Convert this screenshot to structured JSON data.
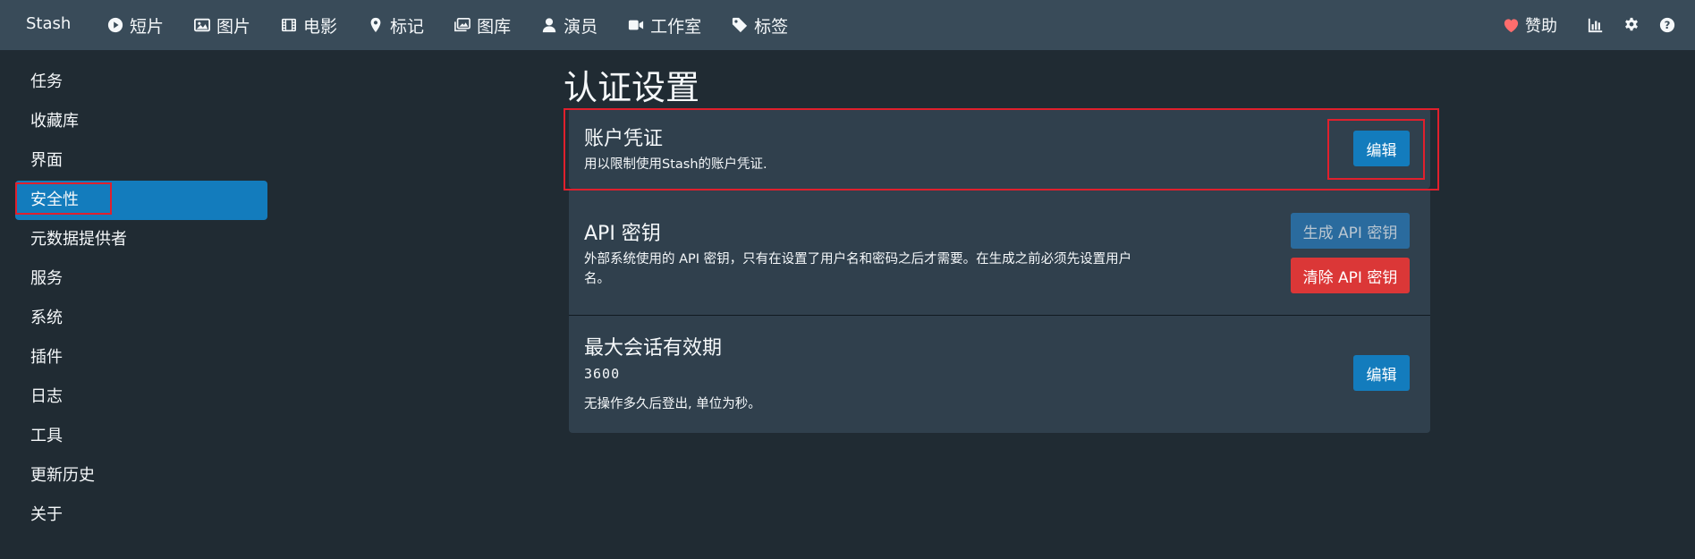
{
  "navbar": {
    "brand": "Stash",
    "items": [
      {
        "label": "短片",
        "icon": "play-circle-icon"
      },
      {
        "label": "图片",
        "icon": "image-icon"
      },
      {
        "label": "电影",
        "icon": "film-icon"
      },
      {
        "label": "标记",
        "icon": "map-marker-icon"
      },
      {
        "label": "图库",
        "icon": "images-icon"
      },
      {
        "label": "演员",
        "icon": "user-icon"
      },
      {
        "label": "工作室",
        "icon": "video-icon"
      },
      {
        "label": "标签",
        "icon": "tag-icon"
      }
    ],
    "donate_label": "赞助",
    "right_icons": [
      "chart-icon",
      "gear-icon",
      "help-icon"
    ]
  },
  "sidebar": {
    "items": [
      {
        "label": "任务"
      },
      {
        "label": "收藏库"
      },
      {
        "label": "界面"
      },
      {
        "label": "安全性",
        "active": true
      },
      {
        "label": "元数据提供者"
      },
      {
        "label": "服务"
      },
      {
        "label": "系统"
      },
      {
        "label": "插件"
      },
      {
        "label": "日志"
      },
      {
        "label": "工具"
      },
      {
        "label": "更新历史"
      },
      {
        "label": "关于"
      }
    ]
  },
  "main": {
    "title": "认证设置",
    "credentials": {
      "title": "账户凭证",
      "description": "用以限制使用Stash的账户凭证.",
      "edit_label": "编辑"
    },
    "api_key": {
      "title": "API 密钥",
      "description_line1": "外部系统使用的 API 密钥，只有在设置了用户名和密码之后才需要。在生成之前必须先设置用户",
      "description_line2": "名。",
      "generate_label": "生成 API 密钥",
      "clear_label": "清除 API 密钥"
    },
    "session": {
      "title": "最大会话有效期",
      "value": "3600",
      "description": "无操作多久后登出, 单位为秒。",
      "edit_label": "编辑"
    }
  },
  "colors": {
    "navbar": "#394b59",
    "background": "#202b33",
    "card": "#30404d",
    "primary": "#137cbd",
    "danger": "#db3737",
    "highlight_box": "#e0202d",
    "heart": "#ff6d6d"
  }
}
